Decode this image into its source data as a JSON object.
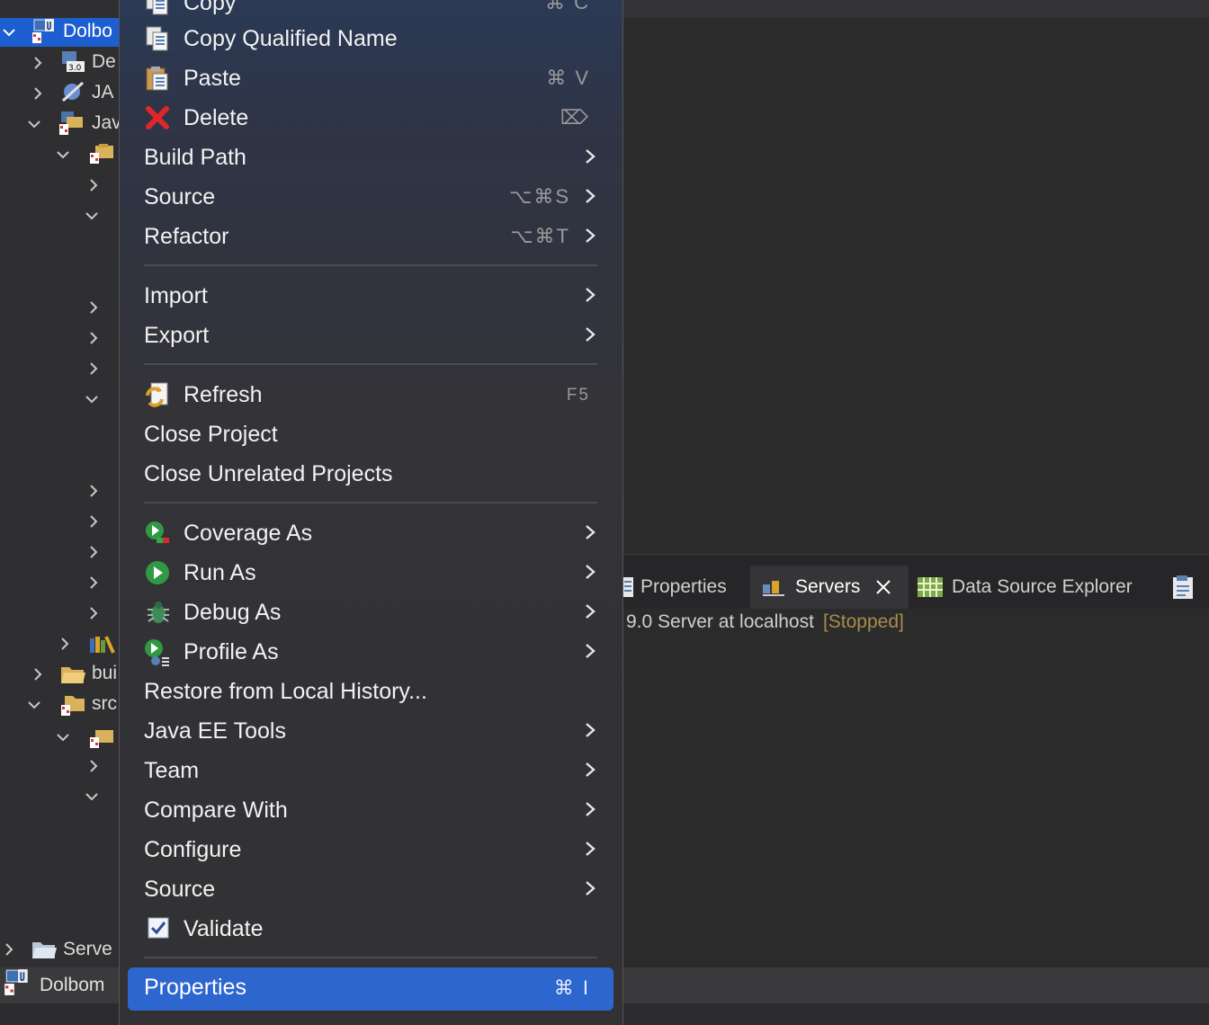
{
  "explorer": {
    "rows": [
      {
        "label": "Dolbo",
        "chevron": "down",
        "icon": "web-project-icon",
        "selected": true
      },
      {
        "label": "De",
        "chevron": "right",
        "icon": "deployment-descriptor-icon"
      },
      {
        "label": "JA",
        "chevron": "right",
        "icon": "jax-ws-icon"
      },
      {
        "label": "Jav",
        "chevron": "down",
        "icon": "java-resources-icon"
      },
      {
        "label": "",
        "chevron": "down",
        "icon": "package-folder-icon"
      },
      {
        "label": "",
        "chevron": "right"
      },
      {
        "label": "",
        "chevron": "down"
      },
      {
        "label": "",
        "chevron": "right"
      },
      {
        "label": "",
        "chevron": "right"
      },
      {
        "label": "",
        "chevron": "right"
      },
      {
        "label": "",
        "chevron": "down"
      },
      {
        "label": "",
        "chevron": "right"
      },
      {
        "label": "",
        "chevron": "right"
      },
      {
        "label": "",
        "chevron": "right"
      },
      {
        "label": "",
        "chevron": "right"
      },
      {
        "label": "",
        "chevron": "right"
      },
      {
        "label": "",
        "chevron": "right",
        "icon": "libraries-icon"
      },
      {
        "label": "bui",
        "chevron": "right",
        "icon": "folder-icon"
      },
      {
        "label": "src",
        "chevron": "down",
        "icon": "source-folder-icon"
      },
      {
        "label": "",
        "chevron": "down",
        "icon": "package-folder-icon"
      },
      {
        "label": "",
        "chevron": "right"
      },
      {
        "label": "",
        "chevron": "down"
      },
      {
        "label": "Serve",
        "chevron": "right",
        "icon": "servers-folder-icon"
      }
    ]
  },
  "bottom_project": {
    "label": "Dolbom",
    "icon": "web-project-icon"
  },
  "menu": {
    "items": [
      {
        "label": "Copy",
        "shortcut": "⌘ C",
        "icon": "copy-icon"
      },
      {
        "label": "Copy Qualified Name",
        "icon": "copy-qualified-name-icon"
      },
      {
        "label": "Paste",
        "shortcut": "⌘ V",
        "icon": "paste-icon"
      },
      {
        "label": "Delete",
        "shortcut": "⌦",
        "icon": "delete-icon"
      },
      {
        "label": "Build Path",
        "submenu": true
      },
      {
        "label": "Source",
        "shortcut": "⌥⌘S",
        "submenu": true
      },
      {
        "label": "Refactor",
        "shortcut": "⌥⌘T",
        "submenu": true
      },
      {
        "label": "Import",
        "submenu": true
      },
      {
        "label": "Export",
        "submenu": true
      },
      {
        "label": "Refresh",
        "shortcut": "F5",
        "icon": "refresh-icon"
      },
      {
        "label": "Close Project"
      },
      {
        "label": "Close Unrelated Projects"
      },
      {
        "label": "Coverage As",
        "submenu": true,
        "icon": "coverage-icon"
      },
      {
        "label": "Run As",
        "submenu": true,
        "icon": "run-icon"
      },
      {
        "label": "Debug As",
        "submenu": true,
        "icon": "debug-icon"
      },
      {
        "label": "Profile As",
        "submenu": true,
        "icon": "profile-icon"
      },
      {
        "label": "Restore from Local History..."
      },
      {
        "label": "Java EE Tools",
        "submenu": true
      },
      {
        "label": "Team",
        "submenu": true
      },
      {
        "label": "Compare With",
        "submenu": true
      },
      {
        "label": "Configure",
        "submenu": true
      },
      {
        "label": "Source",
        "submenu": true
      },
      {
        "label": "Validate",
        "icon": "checkbox-checked-icon"
      },
      {
        "label": "Properties",
        "shortcut": "⌘ I",
        "highlighted": true
      }
    ]
  },
  "tabs": [
    {
      "label": "Properties",
      "icon": "properties-icon"
    },
    {
      "label": "Servers",
      "icon": "servers-icon",
      "active": true,
      "closable": true
    },
    {
      "label": "Data Source Explorer",
      "icon": "data-source-explorer-icon"
    },
    {
      "label": "",
      "icon": "snippets-icon"
    }
  ],
  "servers_view": {
    "server_name": "9.0 Server at localhost",
    "status": "[Stopped]"
  },
  "colors": {
    "selection": "#1d5fd1",
    "menu_highlight": "#2d66cf",
    "stopped_status": "#a98c4e"
  }
}
